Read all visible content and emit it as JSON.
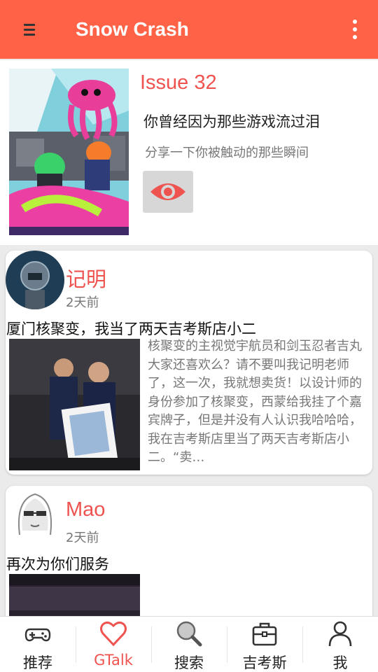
{
  "app": {
    "title": "Snow Crash"
  },
  "issue": {
    "number": "Issue 32",
    "headline": "你曾经因为那些游戏流过泪",
    "subtitle": "分享一下你被触动的那些瞬间"
  },
  "posts": [
    {
      "author": "记明",
      "time": "2天前",
      "title": "厦门核聚变，我当了两天吉考斯店小二",
      "excerpt": "核聚变的主视觉宇航员和剑玉忍者吉丸大家还喜欢么？请不要叫我记明老师了，这一次，我就想卖货！以设计师的身份参加了核聚变，西蒙给我挂了个嘉宾牌子，但是并没有人认识我哈哈哈，我在吉考斯店里当了两天吉考斯店小二。“卖…"
    },
    {
      "author": "Mao",
      "time": "2天前",
      "title": "再次为你们服务"
    }
  ],
  "tabs": [
    {
      "label": "推荐",
      "icon": "gamepad-icon"
    },
    {
      "label": "GTalk",
      "icon": "heart-icon"
    },
    {
      "label": "搜索",
      "icon": "magnifier-icon"
    },
    {
      "label": "吉考斯",
      "icon": "briefcase-icon"
    },
    {
      "label": "我",
      "icon": "person-icon"
    }
  ],
  "active_tab": "GTalk",
  "colors": {
    "primary": "#ff6246",
    "accent": "#ef5350"
  }
}
